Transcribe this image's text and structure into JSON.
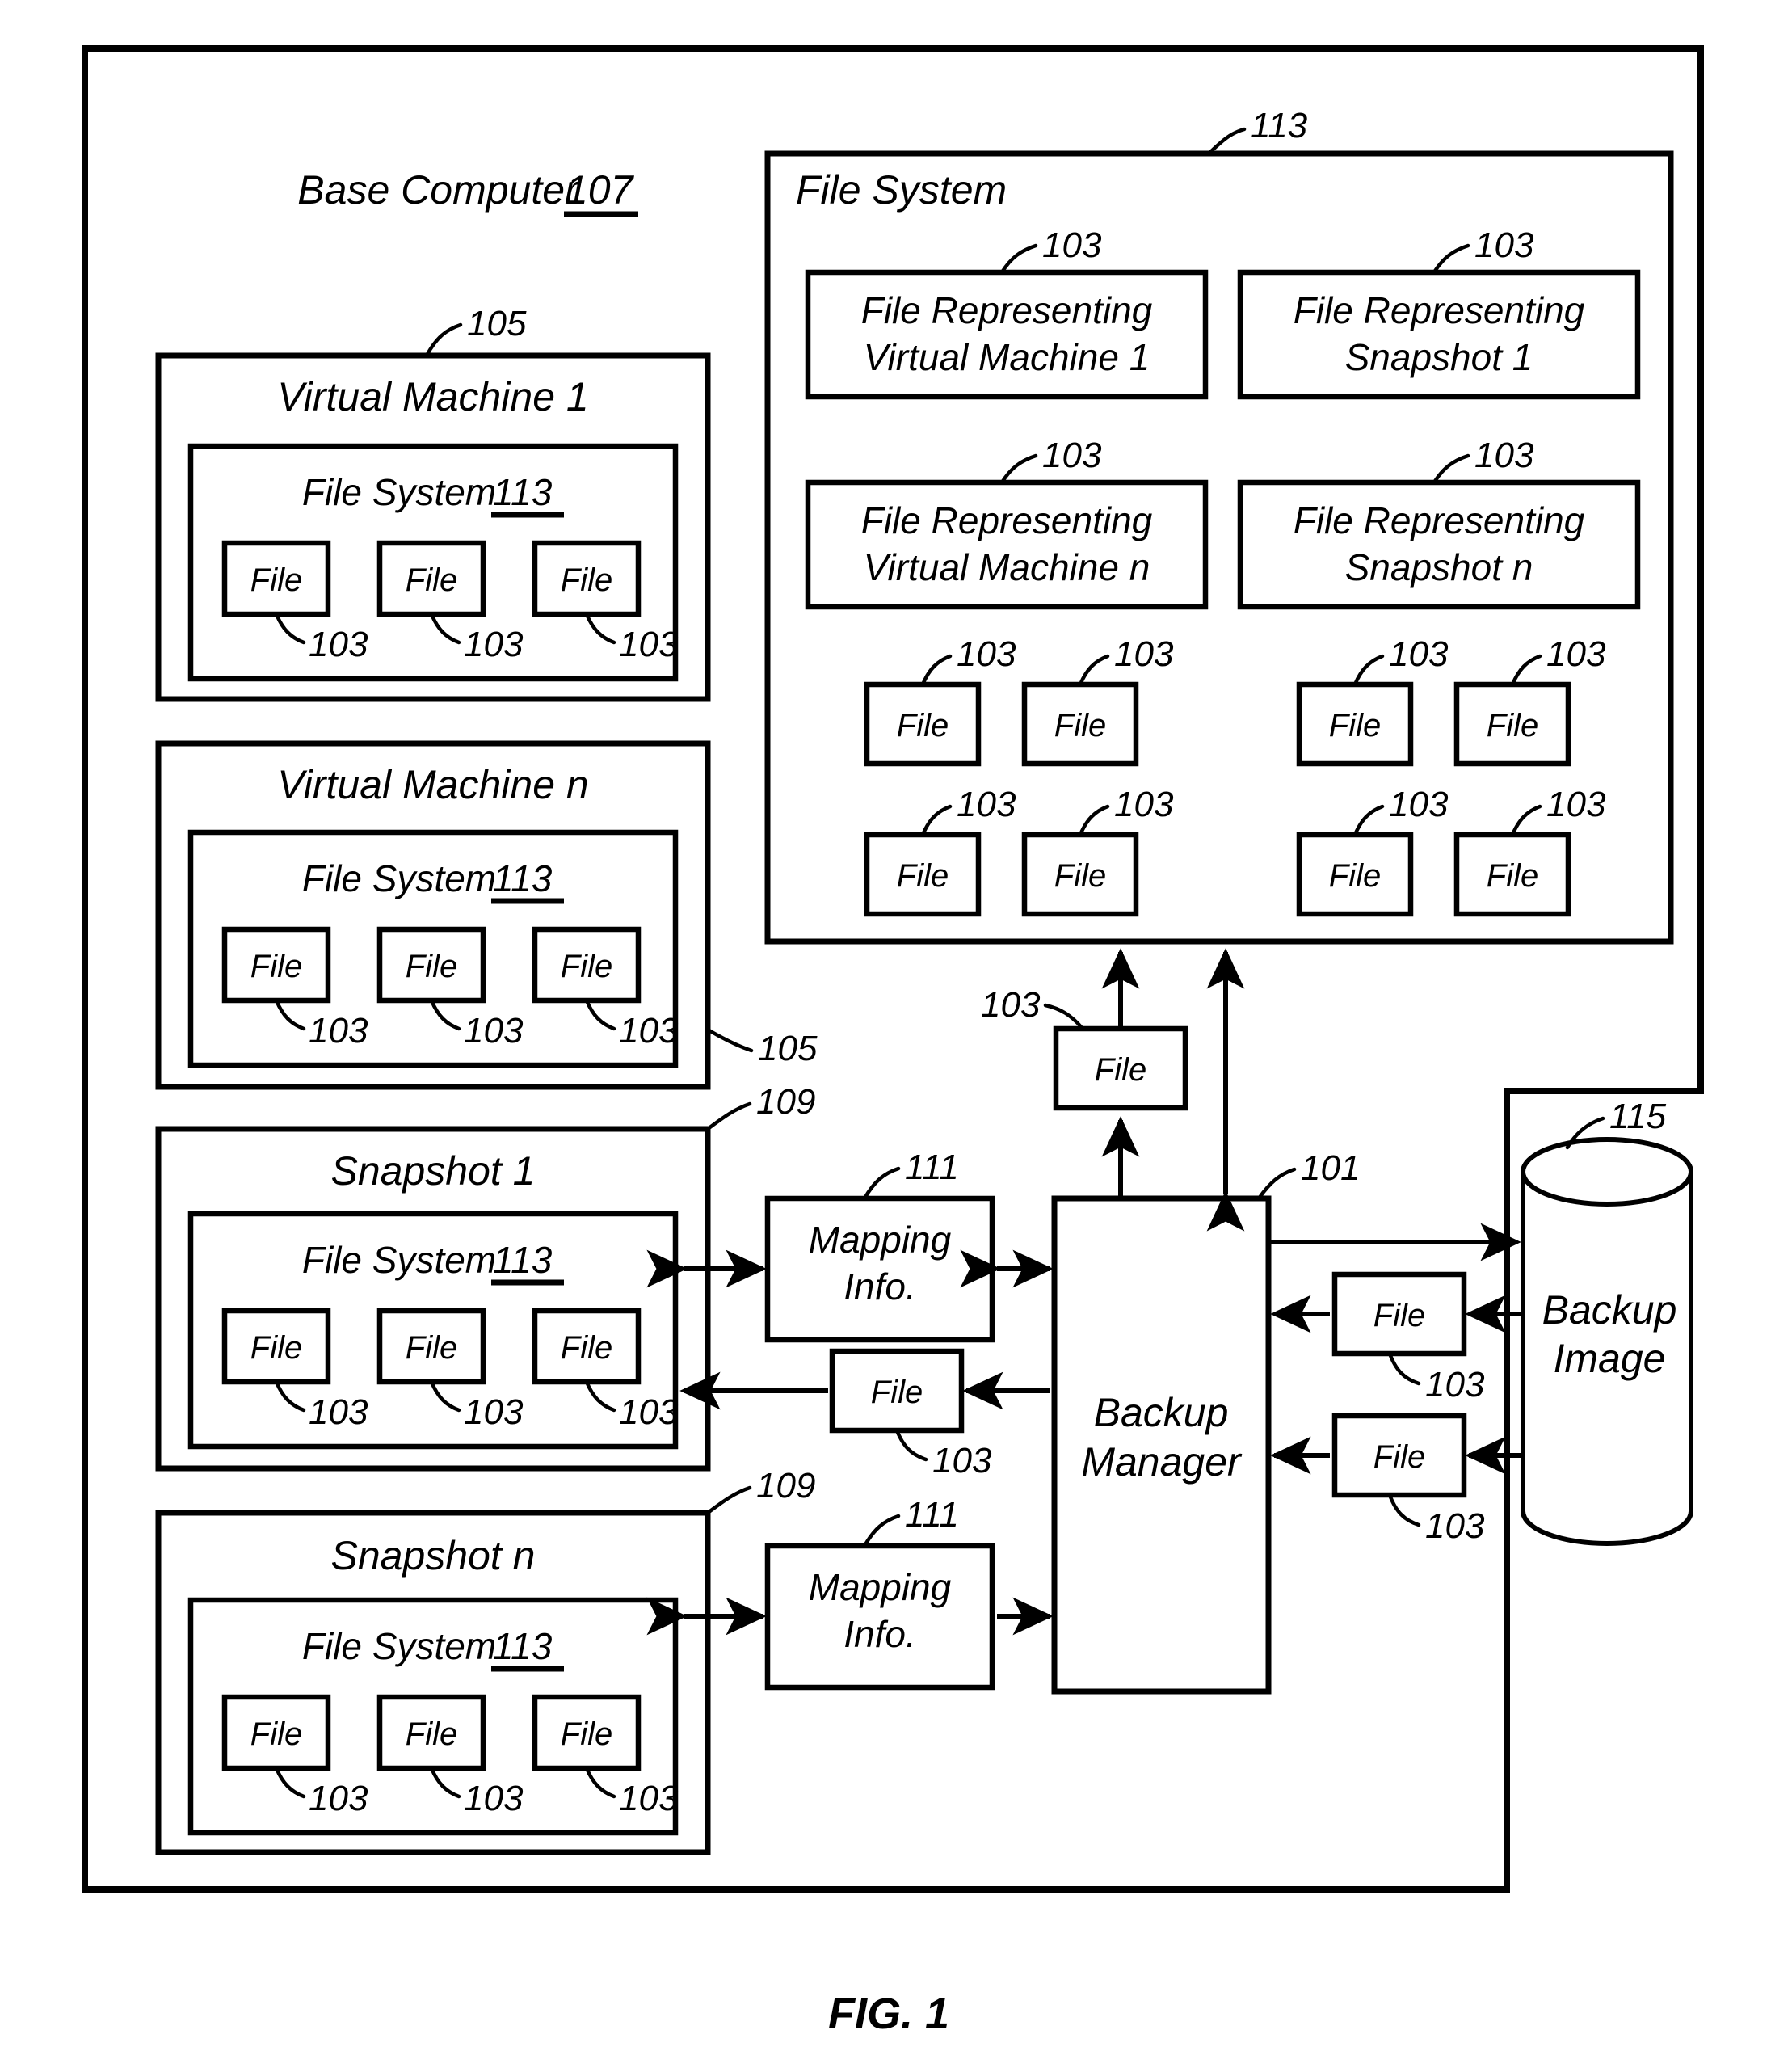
{
  "figure": {
    "caption": "FIG. 1",
    "outer_container": {
      "label": "Base Computer",
      "ref": "107"
    },
    "virtual_machines": [
      {
        "name": "Virtual Machine 1",
        "ref": "105",
        "file_system": {
          "label": "File System",
          "ref": "113"
        },
        "files": [
          {
            "label": "File",
            "ref": "103"
          },
          {
            "label": "File",
            "ref": "103"
          },
          {
            "label": "File",
            "ref": "103"
          }
        ]
      },
      {
        "name": "Virtual Machine n",
        "ref": "105",
        "file_system": {
          "label": "File System",
          "ref": "113"
        },
        "files": [
          {
            "label": "File",
            "ref": "103"
          },
          {
            "label": "File",
            "ref": "103"
          },
          {
            "label": "File",
            "ref": "103"
          }
        ]
      }
    ],
    "snapshots": [
      {
        "name": "Snapshot 1",
        "ref": "109",
        "file_system": {
          "label": "File System",
          "ref": "113"
        },
        "files": [
          {
            "label": "File",
            "ref": "103"
          },
          {
            "label": "File",
            "ref": "103"
          },
          {
            "label": "File",
            "ref": "103"
          }
        ],
        "mapping_info": {
          "label_line1": "Mapping",
          "label_line2": "Info.",
          "ref": "111"
        },
        "restored_file": {
          "label": "File",
          "ref": "103"
        }
      },
      {
        "name": "Snapshot n",
        "ref": "109",
        "file_system": {
          "label": "File System",
          "ref": "113"
        },
        "files": [
          {
            "label": "File",
            "ref": "103"
          },
          {
            "label": "File",
            "ref": "103"
          },
          {
            "label": "File",
            "ref": "103"
          }
        ],
        "mapping_info": {
          "label_line1": "Mapping",
          "label_line2": "Info.",
          "ref": "111"
        }
      }
    ],
    "host_file_system": {
      "label": "File System",
      "ref": "113",
      "representing_files": [
        {
          "line1": "File Representing",
          "line2": "Virtual Machine 1",
          "ref": "103"
        },
        {
          "line1": "File Representing",
          "line2": "Snapshot 1",
          "ref": "103"
        },
        {
          "line1": "File Representing",
          "line2": "Virtual Machine n",
          "ref": "103"
        },
        {
          "line1": "File Representing",
          "line2": "Snapshot n",
          "ref": "103"
        }
      ],
      "file_grid": [
        {
          "label": "File",
          "ref": "103"
        },
        {
          "label": "File",
          "ref": "103"
        },
        {
          "label": "File",
          "ref": "103"
        },
        {
          "label": "File",
          "ref": "103"
        },
        {
          "label": "File",
          "ref": "103"
        },
        {
          "label": "File",
          "ref": "103"
        },
        {
          "label": "File",
          "ref": "103"
        },
        {
          "label": "File",
          "ref": "103"
        }
      ]
    },
    "backup_manager": {
      "label_line1": "Backup",
      "label_line2": "Manager",
      "ref": "101"
    },
    "backup_image": {
      "label_line1": "Backup",
      "label_line2": "Image",
      "ref": "115"
    },
    "transit_files": [
      {
        "label": "File",
        "ref": "103"
      },
      {
        "label": "File",
        "ref": "103"
      },
      {
        "label": "File",
        "ref": "103"
      }
    ]
  }
}
